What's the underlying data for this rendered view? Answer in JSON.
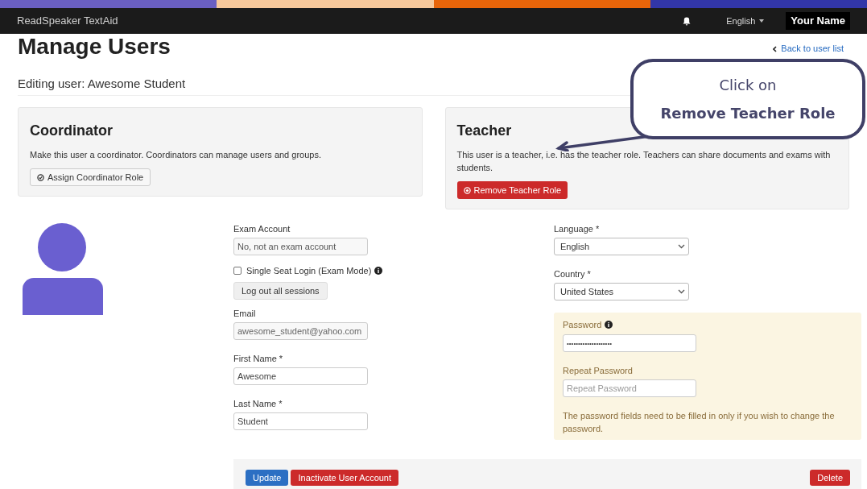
{
  "top_bar": {
    "brand": "ReadSpeaker TextAid",
    "language": "English",
    "user_name": "Your Name"
  },
  "header": {
    "title": "Manage Users",
    "back_link": "Back to user list",
    "subtitle": "Editing user: Awesome Student"
  },
  "roles": [
    {
      "kind": "assign",
      "title": "Coordinator",
      "description": "Make this user a coordinator. Coordinators can manage users and groups.",
      "button": "Assign Coordinator Role"
    },
    {
      "kind": "remove",
      "title": "Teacher",
      "description": "This user is a teacher, i.e. has the teacher role. Teachers can share documents and exams with students.",
      "button": "Remove Teacher Role"
    }
  ],
  "exam_account": {
    "label": "Exam Account",
    "value": "No, not an exam account"
  },
  "single_seat": {
    "label": "Single Seat Login (Exam Mode)",
    "checked": false
  },
  "logout_button": "Log out all sessions",
  "fields": [
    {
      "label": "Email",
      "value": "awesome_student@yahoo.com"
    },
    {
      "label": "First Name *",
      "value": "Awesome"
    },
    {
      "label": "Last Name *",
      "value": "Student"
    }
  ],
  "selects": [
    {
      "label": "Language *",
      "value": "English"
    },
    {
      "label": "Country *",
      "value": "United States"
    }
  ],
  "password": {
    "label": "Password",
    "value": "••••••••••••••••••••",
    "repeat_label": "Repeat Password",
    "repeat_placeholder": "Repeat Password",
    "note": "The password fields need to be filled in only if you wish to change the password."
  },
  "actions": [
    {
      "kind": "primary",
      "label": "Update"
    },
    {
      "kind": "danger",
      "label": "Inactivate User Account"
    },
    {
      "kind": "danger-right",
      "label": "Delete"
    }
  ],
  "callout": {
    "line1": "Click on",
    "line2": "Remove Teacher Role"
  }
}
